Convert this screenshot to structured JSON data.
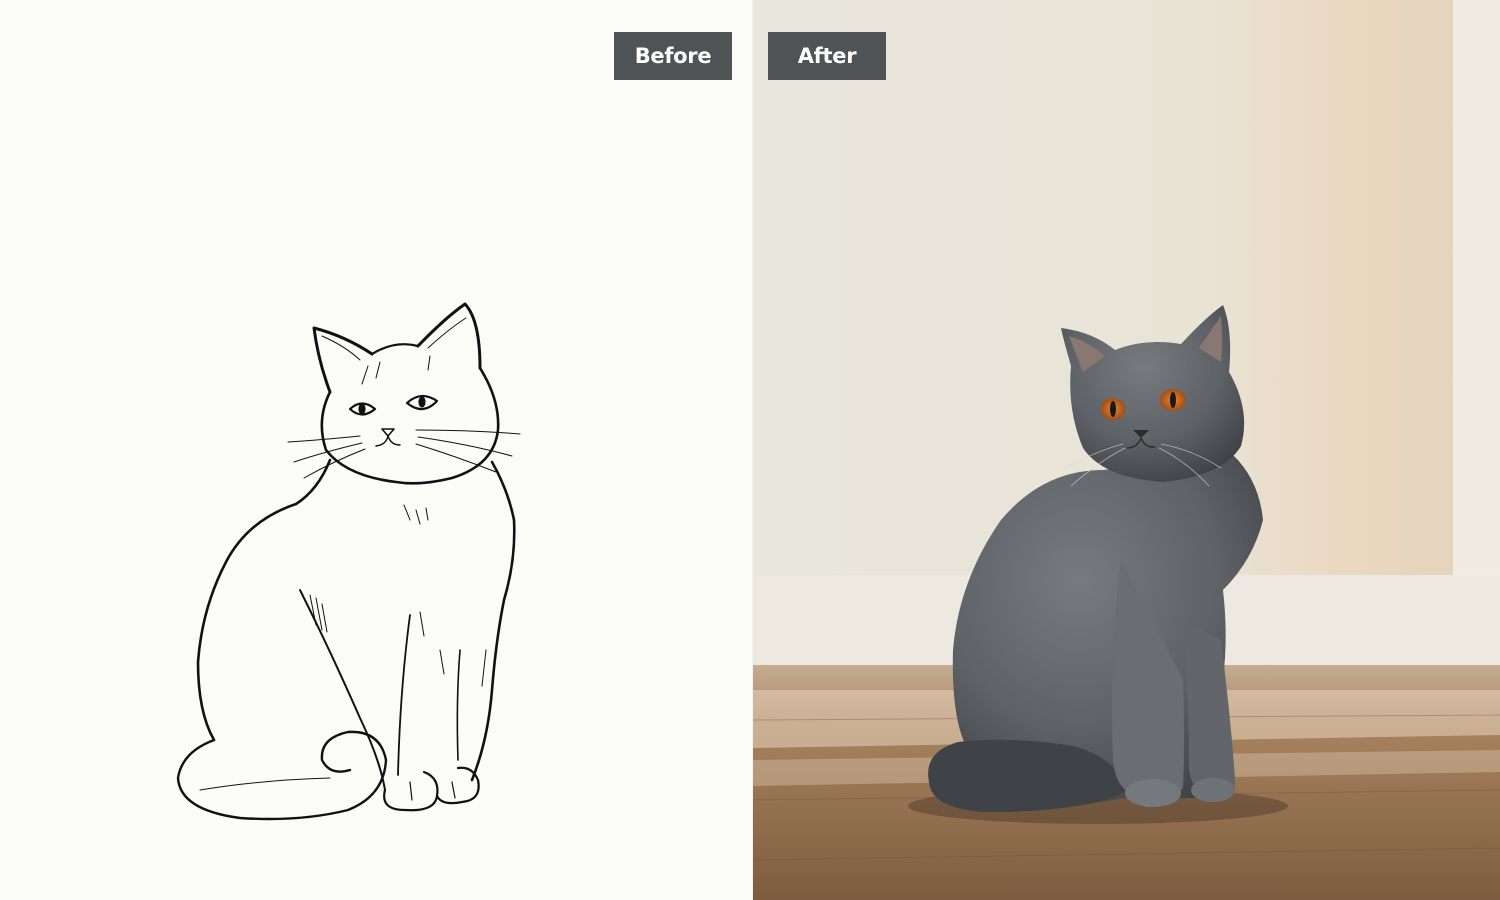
{
  "comparison": {
    "before_label": "Before",
    "after_label": "After",
    "before_image": {
      "subject": "line-drawing-cat",
      "background_color": "#fbfcf8",
      "line_color": "#111111"
    },
    "after_image": {
      "subject": "photo-grey-cat",
      "fur_color": "#5e6266",
      "eye_color": "#c4631a",
      "wall_color": "#e7e2d6",
      "floor_color": "#8c6848"
    }
  },
  "colors": {
    "label_background": "#4f5355",
    "label_text": "#ffffff"
  }
}
